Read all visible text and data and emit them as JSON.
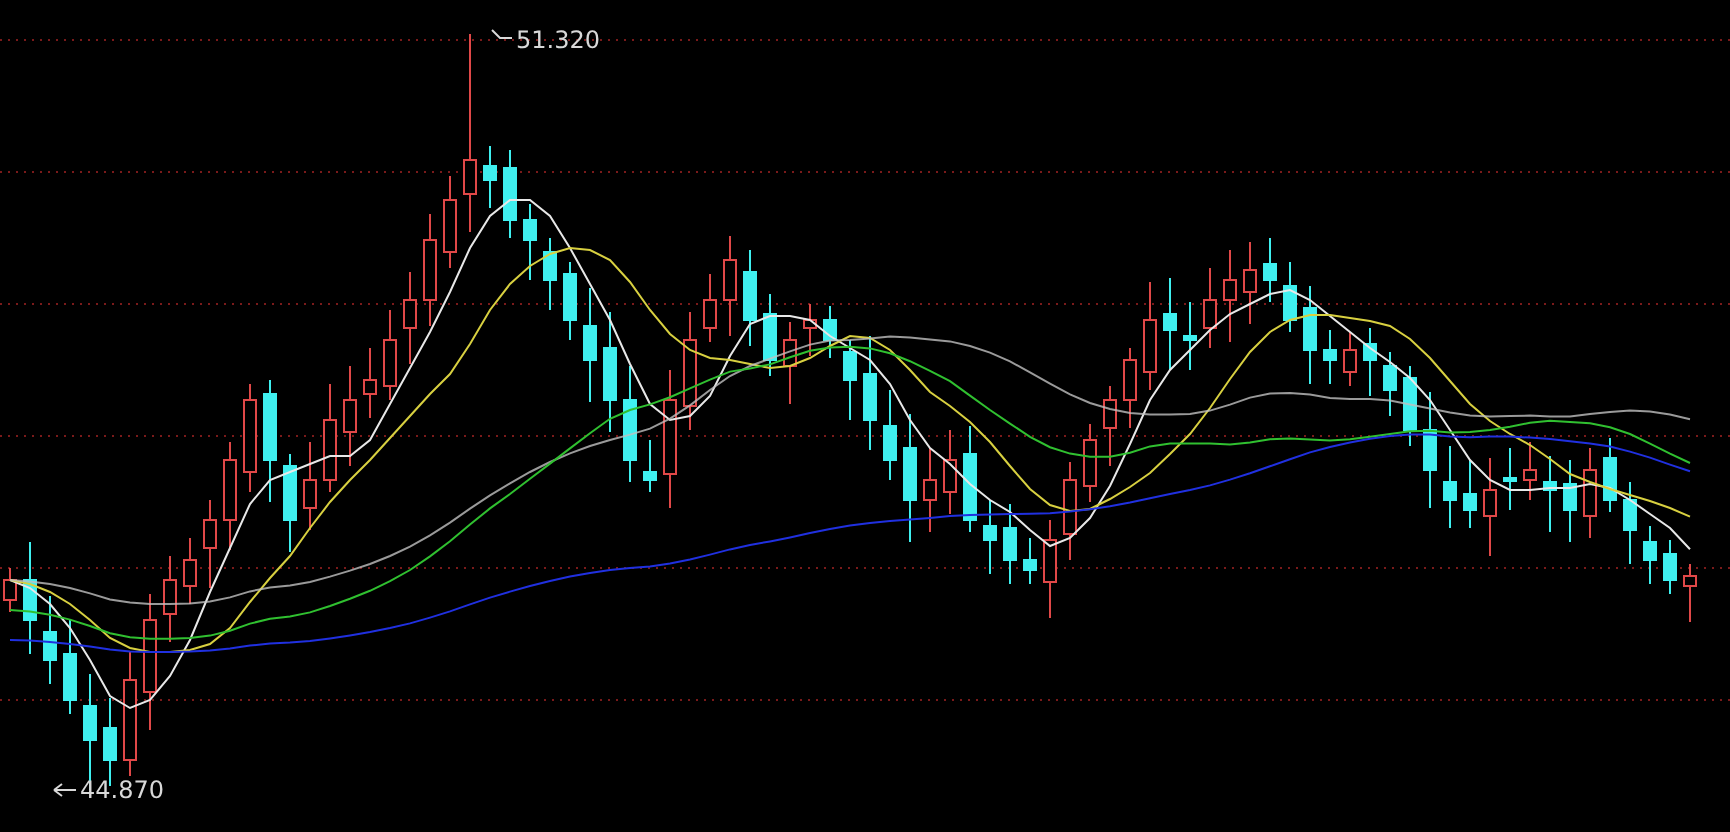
{
  "chart": {
    "high_label": "51.320",
    "low_label": "44.870"
  }
}
